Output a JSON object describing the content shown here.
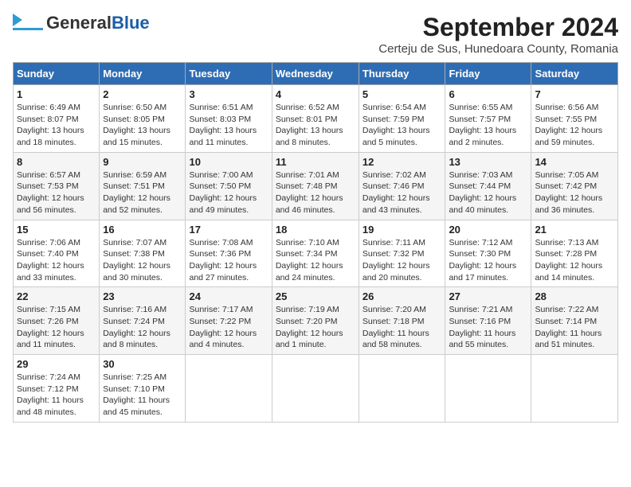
{
  "logo": {
    "general": "General",
    "blue": "Blue"
  },
  "title": "September 2024",
  "subtitle": "Certeju de Sus, Hunedoara County, Romania",
  "headers": [
    "Sunday",
    "Monday",
    "Tuesday",
    "Wednesday",
    "Thursday",
    "Friday",
    "Saturday"
  ],
  "weeks": [
    [
      {
        "num": "1",
        "info": "Sunrise: 6:49 AM\nSunset: 8:07 PM\nDaylight: 13 hours\nand 18 minutes."
      },
      {
        "num": "2",
        "info": "Sunrise: 6:50 AM\nSunset: 8:05 PM\nDaylight: 13 hours\nand 15 minutes."
      },
      {
        "num": "3",
        "info": "Sunrise: 6:51 AM\nSunset: 8:03 PM\nDaylight: 13 hours\nand 11 minutes."
      },
      {
        "num": "4",
        "info": "Sunrise: 6:52 AM\nSunset: 8:01 PM\nDaylight: 13 hours\nand 8 minutes."
      },
      {
        "num": "5",
        "info": "Sunrise: 6:54 AM\nSunset: 7:59 PM\nDaylight: 13 hours\nand 5 minutes."
      },
      {
        "num": "6",
        "info": "Sunrise: 6:55 AM\nSunset: 7:57 PM\nDaylight: 13 hours\nand 2 minutes."
      },
      {
        "num": "7",
        "info": "Sunrise: 6:56 AM\nSunset: 7:55 PM\nDaylight: 12 hours\nand 59 minutes."
      }
    ],
    [
      {
        "num": "8",
        "info": "Sunrise: 6:57 AM\nSunset: 7:53 PM\nDaylight: 12 hours\nand 56 minutes."
      },
      {
        "num": "9",
        "info": "Sunrise: 6:59 AM\nSunset: 7:51 PM\nDaylight: 12 hours\nand 52 minutes."
      },
      {
        "num": "10",
        "info": "Sunrise: 7:00 AM\nSunset: 7:50 PM\nDaylight: 12 hours\nand 49 minutes."
      },
      {
        "num": "11",
        "info": "Sunrise: 7:01 AM\nSunset: 7:48 PM\nDaylight: 12 hours\nand 46 minutes."
      },
      {
        "num": "12",
        "info": "Sunrise: 7:02 AM\nSunset: 7:46 PM\nDaylight: 12 hours\nand 43 minutes."
      },
      {
        "num": "13",
        "info": "Sunrise: 7:03 AM\nSunset: 7:44 PM\nDaylight: 12 hours\nand 40 minutes."
      },
      {
        "num": "14",
        "info": "Sunrise: 7:05 AM\nSunset: 7:42 PM\nDaylight: 12 hours\nand 36 minutes."
      }
    ],
    [
      {
        "num": "15",
        "info": "Sunrise: 7:06 AM\nSunset: 7:40 PM\nDaylight: 12 hours\nand 33 minutes."
      },
      {
        "num": "16",
        "info": "Sunrise: 7:07 AM\nSunset: 7:38 PM\nDaylight: 12 hours\nand 30 minutes."
      },
      {
        "num": "17",
        "info": "Sunrise: 7:08 AM\nSunset: 7:36 PM\nDaylight: 12 hours\nand 27 minutes."
      },
      {
        "num": "18",
        "info": "Sunrise: 7:10 AM\nSunset: 7:34 PM\nDaylight: 12 hours\nand 24 minutes."
      },
      {
        "num": "19",
        "info": "Sunrise: 7:11 AM\nSunset: 7:32 PM\nDaylight: 12 hours\nand 20 minutes."
      },
      {
        "num": "20",
        "info": "Sunrise: 7:12 AM\nSunset: 7:30 PM\nDaylight: 12 hours\nand 17 minutes."
      },
      {
        "num": "21",
        "info": "Sunrise: 7:13 AM\nSunset: 7:28 PM\nDaylight: 12 hours\nand 14 minutes."
      }
    ],
    [
      {
        "num": "22",
        "info": "Sunrise: 7:15 AM\nSunset: 7:26 PM\nDaylight: 12 hours\nand 11 minutes."
      },
      {
        "num": "23",
        "info": "Sunrise: 7:16 AM\nSunset: 7:24 PM\nDaylight: 12 hours\nand 8 minutes."
      },
      {
        "num": "24",
        "info": "Sunrise: 7:17 AM\nSunset: 7:22 PM\nDaylight: 12 hours\nand 4 minutes."
      },
      {
        "num": "25",
        "info": "Sunrise: 7:19 AM\nSunset: 7:20 PM\nDaylight: 12 hours\nand 1 minute."
      },
      {
        "num": "26",
        "info": "Sunrise: 7:20 AM\nSunset: 7:18 PM\nDaylight: 11 hours\nand 58 minutes."
      },
      {
        "num": "27",
        "info": "Sunrise: 7:21 AM\nSunset: 7:16 PM\nDaylight: 11 hours\nand 55 minutes."
      },
      {
        "num": "28",
        "info": "Sunrise: 7:22 AM\nSunset: 7:14 PM\nDaylight: 11 hours\nand 51 minutes."
      }
    ],
    [
      {
        "num": "29",
        "info": "Sunrise: 7:24 AM\nSunset: 7:12 PM\nDaylight: 11 hours\nand 48 minutes."
      },
      {
        "num": "30",
        "info": "Sunrise: 7:25 AM\nSunset: 7:10 PM\nDaylight: 11 hours\nand 45 minutes."
      },
      {
        "num": "",
        "info": ""
      },
      {
        "num": "",
        "info": ""
      },
      {
        "num": "",
        "info": ""
      },
      {
        "num": "",
        "info": ""
      },
      {
        "num": "",
        "info": ""
      }
    ]
  ]
}
